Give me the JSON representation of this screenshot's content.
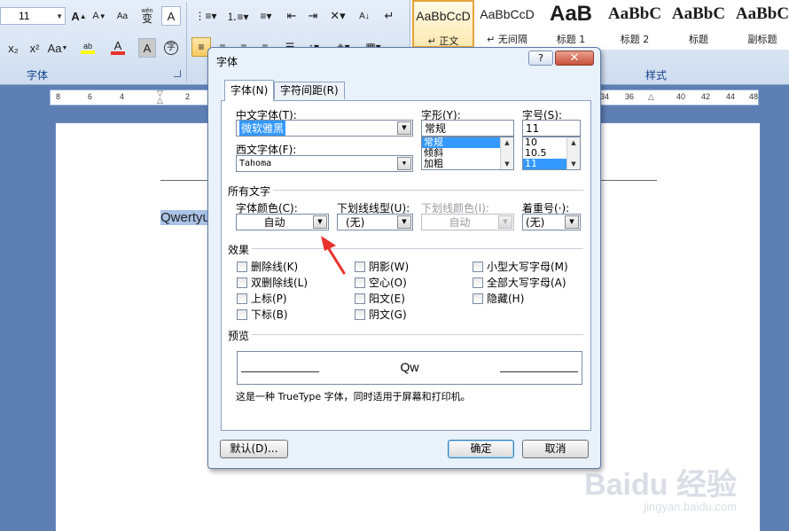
{
  "ribbon": {
    "font_size_value": "11",
    "font_group_label": "字体",
    "styles_group_label": "样式",
    "styles": [
      {
        "preview": "AaBbCcD",
        "name": "↵ 正文"
      },
      {
        "preview": "AaBbCcD",
        "name": "↵ 无间隔"
      },
      {
        "preview": "AaB",
        "name": "标题 1"
      },
      {
        "preview": "AaBbC",
        "name": "标题 2"
      },
      {
        "preview": "AaBbC",
        "name": "标题"
      },
      {
        "preview": "AaBbC",
        "name": "副标题"
      }
    ],
    "grow_font": "A",
    "shrink_font": "A",
    "clear_format": "Aa",
    "phonetic": "wén",
    "phonetic_char": "变",
    "char_border": "A",
    "subscript": "x₂",
    "superscript": "x²",
    "change_case": "Aa",
    "highlight": "ab",
    "font_color": "A",
    "char_shading": "A",
    "enclose_char": "字"
  },
  "ruler": {
    "numbers_left": [
      "8",
      "6",
      "4",
      "2"
    ],
    "numbers_right": [
      "34",
      "36",
      "40",
      "42",
      "44",
      "48"
    ]
  },
  "document": {
    "text": "Qwertyu"
  },
  "watermark": {
    "logo": "Baidu 经验",
    "url": "jingyan.baidu.com"
  },
  "dialog": {
    "title": "字体",
    "help_label": "?",
    "close_label": "✕",
    "tabs": [
      {
        "label": "字体(N)",
        "active": true
      },
      {
        "label": "字符间距(R)",
        "active": false
      }
    ],
    "chinese_font_label": "中文字体(T):",
    "chinese_font_value": "微软雅黑",
    "western_font_label": "西文字体(F):",
    "western_font_value": "Tahoma",
    "style_label": "字形(Y):",
    "style_value": "常规",
    "style_options": [
      "常规",
      "倾斜",
      "加粗"
    ],
    "size_label": "字号(S):",
    "size_value": "11",
    "size_options": [
      "10",
      "10.5",
      "11"
    ],
    "all_text_label": "所有文字",
    "font_color_label": "字体颜色(C):",
    "font_color_value": "自动",
    "underline_style_label": "下划线线型(U):",
    "underline_style_value": "(无)",
    "underline_color_label": "下划线颜色(I):",
    "underline_color_value": "自动",
    "emphasis_label": "着重号(·):",
    "emphasis_value": "(无)",
    "effects_label": "效果",
    "effects_col1": [
      "删除线(K)",
      "双删除线(L)",
      "上标(P)",
      "下标(B)"
    ],
    "effects_col2": [
      "阴影(W)",
      "空心(O)",
      "阳文(E)",
      "阴文(G)"
    ],
    "effects_col3": [
      "小型大写字母(M)",
      "全部大写字母(A)",
      "隐藏(H)"
    ],
    "preview_label": "预览",
    "preview_text": "Qw",
    "preview_note": "这是一种 TrueType 字体，同时适用于屏幕和打印机。",
    "default_button": "默认(D)...",
    "ok_button": "确定",
    "cancel_button": "取消"
  },
  "colors": {
    "annotation_arrow": "#e8322b",
    "selection": "#3399ff",
    "ribbon_label": "#15428b"
  }
}
